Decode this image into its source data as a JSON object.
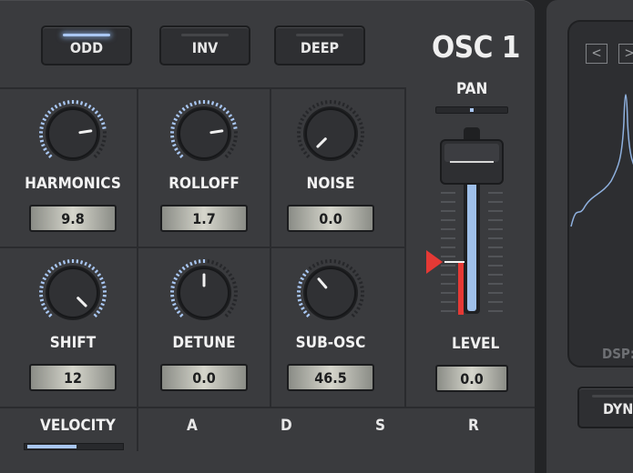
{
  "colors": {
    "accent": "#a9c7f3",
    "marker": "#e53935",
    "panel": "#3a3b3e"
  },
  "osc": {
    "title": "OSC 1"
  },
  "mode_buttons": [
    {
      "label": "ODD",
      "active": true
    },
    {
      "label": "INV",
      "active": false
    },
    {
      "label": "DEEP",
      "active": false
    }
  ],
  "knobs": [
    {
      "label": "HARMONICS",
      "value": "9.8",
      "level": 0.8
    },
    {
      "label": "ROLLOFF",
      "value": "1.7",
      "level": 0.8
    },
    {
      "label": "NOISE",
      "value": "0.0",
      "level": 0.0
    },
    {
      "label": "SHIFT",
      "value": "12",
      "level": 1.0
    },
    {
      "label": "DETUNE",
      "value": "0.0",
      "level": 0.5
    },
    {
      "label": "SUB-OSC",
      "value": "46.5",
      "level": 0.35
    }
  ],
  "pan": {
    "label": "PAN"
  },
  "level": {
    "label": "LEVEL",
    "value": "0.0"
  },
  "velocity": {
    "label": "VELOCITY"
  },
  "adsr": {
    "a": "A",
    "d": "D",
    "s": "S",
    "r": "R"
  },
  "scope": {
    "prev": "<",
    "next": ">",
    "dsp_label": "DSP:"
  },
  "dyn_button": {
    "label": "DYN"
  }
}
